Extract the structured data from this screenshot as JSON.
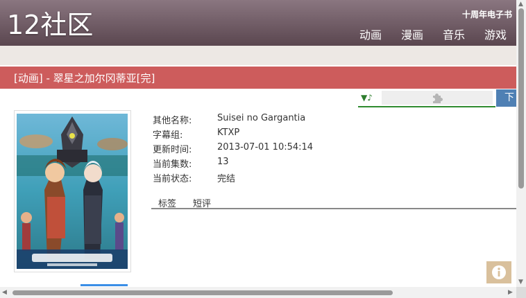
{
  "header": {
    "logo": "12社区",
    "anniversary": "十周年电子书",
    "nav": [
      "动画",
      "漫画",
      "音乐",
      "游戏"
    ]
  },
  "page_title": "[动画] - 翠星之加尔冈蒂亚[完]",
  "download_label": "下",
  "info": [
    {
      "label": "其他名称:",
      "value": "Suisei no Gargantia"
    },
    {
      "label": "字幕组:",
      "value": "KTXP"
    },
    {
      "label": "更新时间:",
      "value": "2013-07-01 10:54:14"
    },
    {
      "label": "当前集数:",
      "value": "13"
    },
    {
      "label": "当前状态:",
      "value": "完结"
    }
  ],
  "tabs": [
    "标签",
    "短评"
  ],
  "icons": {
    "music": "music-note-icon",
    "plugin": "puzzle-piece-icon",
    "info": "info-icon"
  }
}
